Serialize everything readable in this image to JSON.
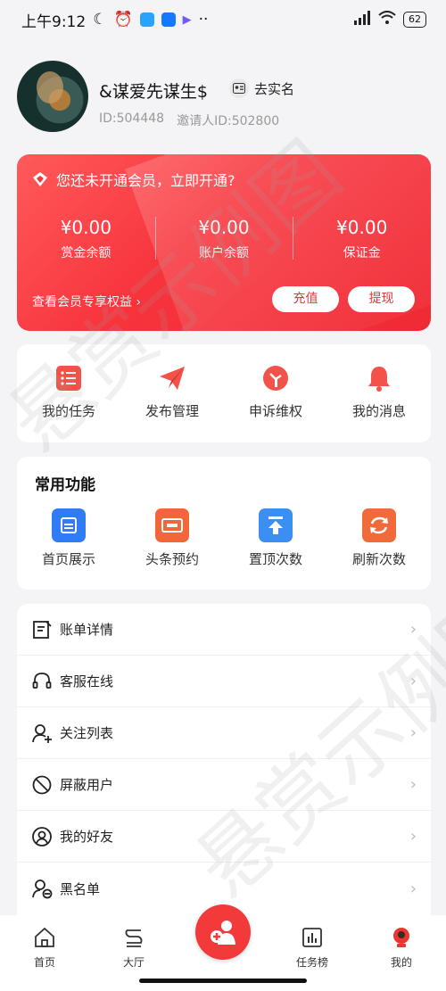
{
  "status_bar": {
    "time": "上午9:12",
    "battery": "62"
  },
  "profile": {
    "nickname": "&谋爱先谋生$",
    "verify_label": "去实名",
    "id_text": "ID:504448",
    "inviter_text": "邀请人ID:502800"
  },
  "vip_card": {
    "title": "您还未开通会员，立即开通?",
    "balances": [
      {
        "value": "¥0.00",
        "label": "赏金余额"
      },
      {
        "value": "¥0.00",
        "label": "账户余额"
      },
      {
        "value": "¥0.00",
        "label": "保证金"
      }
    ],
    "benefit_link": "查看会员专享权益",
    "benefit_arrow": "›",
    "recharge_label": "充值",
    "withdraw_label": "提现"
  },
  "quick_actions": [
    {
      "label": "我的任务",
      "icon": "task-list-icon"
    },
    {
      "label": "发布管理",
      "icon": "paper-plane-icon"
    },
    {
      "label": "申诉维权",
      "icon": "appeal-icon"
    },
    {
      "label": "我的消息",
      "icon": "bell-icon"
    }
  ],
  "common": {
    "title": "常用功能",
    "items": [
      {
        "label": "首页展示",
        "icon": "home-display-icon",
        "color": "#2f7cf6"
      },
      {
        "label": "头条预约",
        "icon": "headline-icon",
        "color": "#f2663a"
      },
      {
        "label": "置顶次数",
        "icon": "pin-top-icon",
        "color": "#3d8ef2"
      },
      {
        "label": "刷新次数",
        "icon": "refresh-icon",
        "color": "#f06a3a"
      }
    ]
  },
  "menu": [
    {
      "label": "账单详情",
      "icon": "bill-icon"
    },
    {
      "label": "客服在线",
      "icon": "headset-icon"
    },
    {
      "label": "关注列表",
      "icon": "follow-user-icon"
    },
    {
      "label": "屏蔽用户",
      "icon": "block-icon"
    },
    {
      "label": "我的好友",
      "icon": "friend-icon"
    },
    {
      "label": "黑名单",
      "icon": "blacklist-icon"
    }
  ],
  "menu_arrow": "›",
  "tabbar": [
    {
      "label": "首页",
      "icon": "home-icon"
    },
    {
      "label": "大厅",
      "icon": "hall-icon"
    },
    {
      "label": "",
      "icon": "publish-icon"
    },
    {
      "label": "任务榜",
      "icon": "chart-icon"
    },
    {
      "label": "我的",
      "icon": "profile-icon"
    }
  ],
  "colors": {
    "brand_red": "#f23a3a",
    "card_gradient_start": "#ff5a5a",
    "card_gradient_end": "#f02a35"
  },
  "watermark_text": "悬赏示例图"
}
